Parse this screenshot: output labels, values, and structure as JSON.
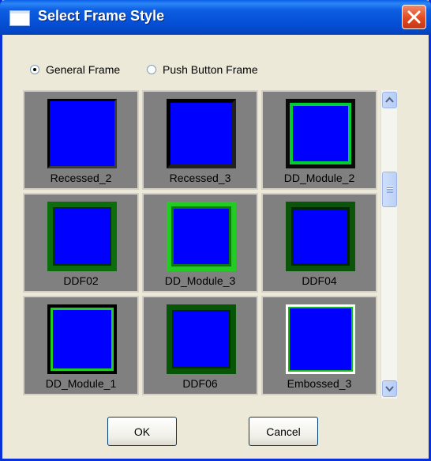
{
  "window": {
    "title": "Select Frame Style"
  },
  "radios": [
    {
      "label": "General Frame",
      "selected": true
    },
    {
      "label": "Push Button Frame",
      "selected": false
    }
  ],
  "frames": [
    {
      "label": "Recessed_2"
    },
    {
      "label": "Recessed_3"
    },
    {
      "label": "DD_Module_2"
    },
    {
      "label": "DDF02"
    },
    {
      "label": "DD_Module_3"
    },
    {
      "label": "DDF04"
    },
    {
      "label": "DD_Module_1"
    },
    {
      "label": "DDF06"
    },
    {
      "label": "Embossed_3"
    }
  ],
  "buttons": {
    "ok": "OK",
    "cancel": "Cancel"
  },
  "colors": {
    "frame_fill": "#0000ff",
    "cell_background": "#808080",
    "title_bar": "#0a5ee8",
    "close_button": "#e04a20"
  },
  "icons": {
    "title": "window-icon",
    "close": "close-icon",
    "scroll_up": "chevron-up-icon",
    "scroll_down": "chevron-down-icon"
  }
}
